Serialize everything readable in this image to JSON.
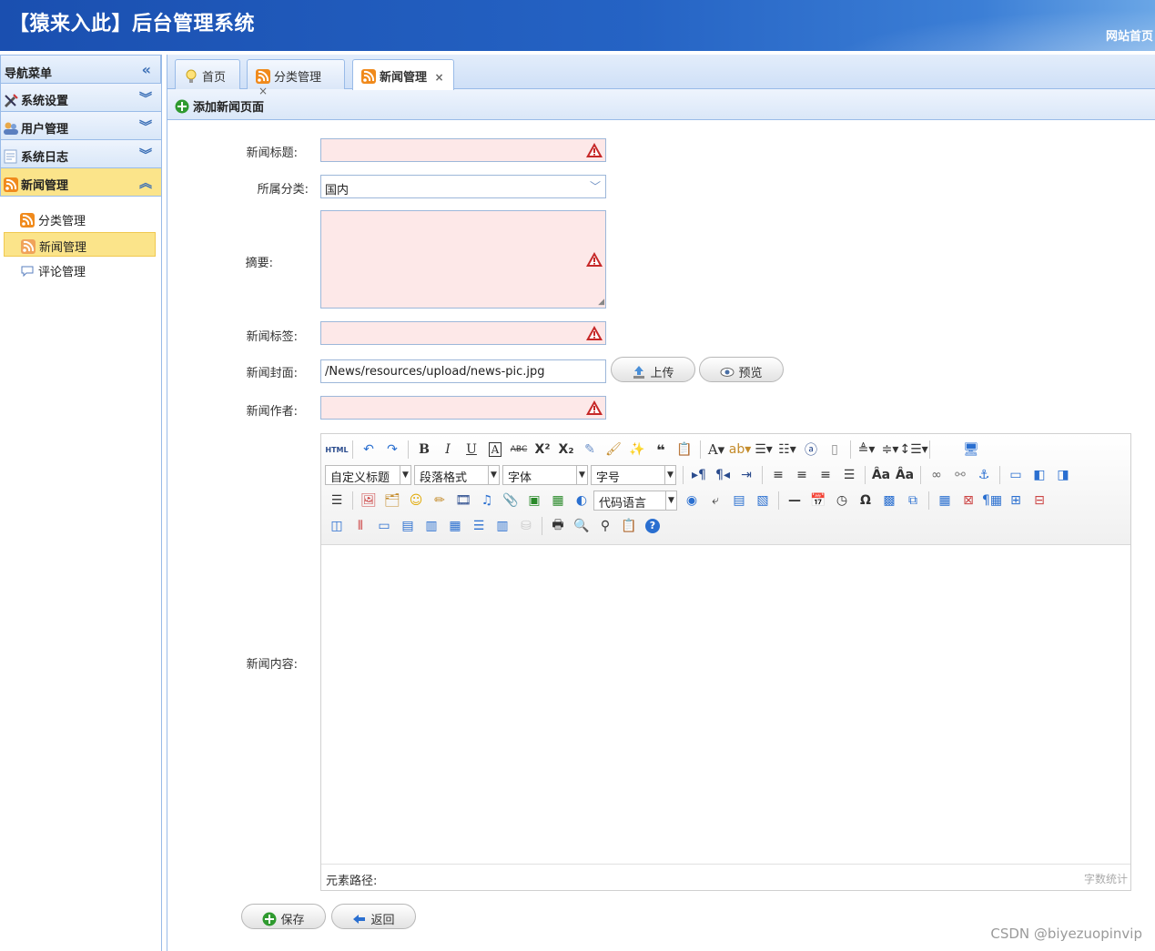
{
  "header": {
    "title": "【猿来入此】后台管理系统",
    "site_link": "网站首页"
  },
  "sidebar": {
    "title": "导航菜单",
    "menus": [
      {
        "label": "系统设置",
        "icon": "tools-icon"
      },
      {
        "label": "用户管理",
        "icon": "users-icon"
      },
      {
        "label": "系统日志",
        "icon": "log-icon"
      },
      {
        "label": "新闻管理",
        "icon": "rss-icon"
      }
    ],
    "sub_items": [
      {
        "label": "分类管理",
        "icon": "rss-icon"
      },
      {
        "label": "新闻管理",
        "icon": "rss-icon"
      },
      {
        "label": "评论管理",
        "icon": "comment-icon"
      }
    ]
  },
  "tabs": [
    {
      "label": "首页",
      "icon": "bulb-icon"
    },
    {
      "label": "分类管理",
      "icon": "rss-icon",
      "close": "×"
    },
    {
      "label": "新闻管理",
      "icon": "rss-icon",
      "close": "×"
    }
  ],
  "panel": {
    "title": "添加新闻页面"
  },
  "form": {
    "title_label": "新闻标题:",
    "category_label": "所属分类:",
    "category_value": "国内",
    "summary_label": "摘要:",
    "tags_label": "新闻标签:",
    "cover_label": "新闻封面:",
    "cover_value": "/News/resources/upload/news-pic.jpg",
    "upload_button": "上传",
    "preview_button": "预览",
    "author_label": "新闻作者:",
    "content_label": "新闻内容:"
  },
  "editor": {
    "combos": {
      "custom_title": "自定义标题",
      "paragraph": "段落格式",
      "font": "字体",
      "size": "字号",
      "code_lang": "代码语言"
    },
    "path_label": "元素路径:",
    "word_count": "字数统计"
  },
  "actions": {
    "save": "保存",
    "back": "返回"
  },
  "watermark": "CSDN @biyezuopinvip"
}
